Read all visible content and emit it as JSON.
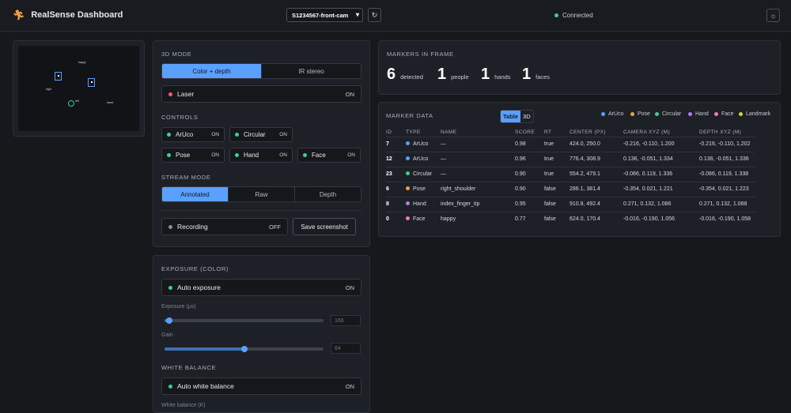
{
  "app": {
    "title": "RealSense Dashboard",
    "camera": "S1234567-front-cam",
    "status": "Connected"
  },
  "icons": {
    "logo": "figure-icon",
    "refresh": "refresh-icon",
    "theme": "sun-icon",
    "select": "chevron-down-icon"
  },
  "colors": {
    "accent": "#5aa0ff",
    "connected": "#3ecf8e",
    "laser": "#ff5c5c",
    "recording_off": "#8a8f98"
  },
  "preview": {
    "markers": [
      "happy",
      "right",
      "left",
      "hand"
    ]
  },
  "mode3d": {
    "title": "3D MODE",
    "options": [
      "Color + depth",
      "IR stereo"
    ],
    "selected": "Color + depth",
    "laser_label": "Laser",
    "laser_state": "ON"
  },
  "controls": {
    "title": "CONTROLS",
    "items": [
      {
        "label": "ArUco",
        "state": "ON",
        "color": "#3ecf8e"
      },
      {
        "label": "Circular",
        "state": "ON",
        "color": "#3ecf8e"
      },
      {
        "label": "Pose",
        "state": "ON",
        "color": "#3ecf8e"
      },
      {
        "label": "Hand",
        "state": "ON",
        "color": "#3ecf8e"
      },
      {
        "label": "Face",
        "state": "ON",
        "color": "#3ecf8e"
      }
    ]
  },
  "stream": {
    "title": "STREAM MODE",
    "options": [
      "Annotated",
      "Raw",
      "Depth"
    ],
    "selected": "Annotated",
    "recording_label": "Recording",
    "recording_state": "OFF",
    "screenshot_label": "Save screenshot"
  },
  "exposure": {
    "title": "EXPOSURE (COLOR)",
    "auto_label": "Auto exposure",
    "auto_state": "ON",
    "exposure_label": "Exposure (µs)",
    "exposure_value": "166",
    "exposure_fraction": 0.03,
    "gain_label": "Gain",
    "gain_value": "64",
    "gain_fraction": 0.5
  },
  "white_balance": {
    "title": "WHITE BALANCE",
    "auto_label": "Auto white balance",
    "auto_state": "ON",
    "wb_label": "White balance (K)"
  },
  "markers_in_frame": {
    "title": "MARKERS IN FRAME",
    "stats": [
      {
        "value": "6",
        "label": "detected"
      },
      {
        "value": "1",
        "label": "people"
      },
      {
        "value": "1",
        "label": "hands"
      },
      {
        "value": "1",
        "label": "faces"
      }
    ]
  },
  "marker_data": {
    "title": "MARKER DATA",
    "views": [
      "Table",
      "3D"
    ],
    "selected_view": "Table",
    "legend": [
      {
        "label": "ArUco",
        "color": "#5aa0ff"
      },
      {
        "label": "Pose",
        "color": "#f0a040"
      },
      {
        "label": "Circular",
        "color": "#3ecf8e"
      },
      {
        "label": "Hand",
        "color": "#b07cf0"
      },
      {
        "label": "Face",
        "color": "#f07cb0"
      },
      {
        "label": "Landmark",
        "color": "#d8d040"
      }
    ],
    "columns": [
      "ID",
      "TYPE",
      "NAME",
      "SCORE",
      "RT",
      "CENTER (PX)",
      "CAMERA XYZ (M)",
      "DEPTH XYZ (M)"
    ],
    "rows": [
      {
        "id": "7",
        "type": "ArUco",
        "color": "#5aa0ff",
        "name": "—",
        "score": "0.98",
        "rt": "true",
        "center": "424.0, 250.0",
        "camera": "-0.216, -0.110, 1.200",
        "depth": "-0.216, -0.110, 1.202"
      },
      {
        "id": "12",
        "type": "ArUco",
        "color": "#5aa0ff",
        "name": "—",
        "score": "0.96",
        "rt": "true",
        "center": "776.4, 308.9",
        "camera": "0.136, -0.051, 1.334",
        "depth": "0.136, -0.051, 1.336"
      },
      {
        "id": "23",
        "type": "Circular",
        "color": "#3ecf8e",
        "name": "—",
        "score": "0.90",
        "rt": "true",
        "center": "554.2, 479.1",
        "camera": "-0.086, 0.119, 1.336",
        "depth": "-0.086, 0.119, 1.338"
      },
      {
        "id": "6",
        "type": "Pose",
        "color": "#f0a040",
        "name": "right_shoulder",
        "score": "0.90",
        "rt": "false",
        "center": "286.1, 381.4",
        "camera": "-0.354, 0.021, 1.221",
        "depth": "-0.354, 0.021, 1.223"
      },
      {
        "id": "8",
        "type": "Hand",
        "color": "#b07cf0",
        "name": "index_finger_tip",
        "score": "0.95",
        "rt": "false",
        "center": "910.8, 492.4",
        "camera": "0.271, 0.132, 1.086",
        "depth": "0.271, 0.132, 1.088"
      },
      {
        "id": "0",
        "type": "Face",
        "color": "#f07cb0",
        "name": "happy",
        "score": "0.77",
        "rt": "false",
        "center": "624.0, 170.4",
        "camera": "-0.016, -0.190, 1.056",
        "depth": "-0.016, -0.190, 1.058"
      }
    ]
  }
}
